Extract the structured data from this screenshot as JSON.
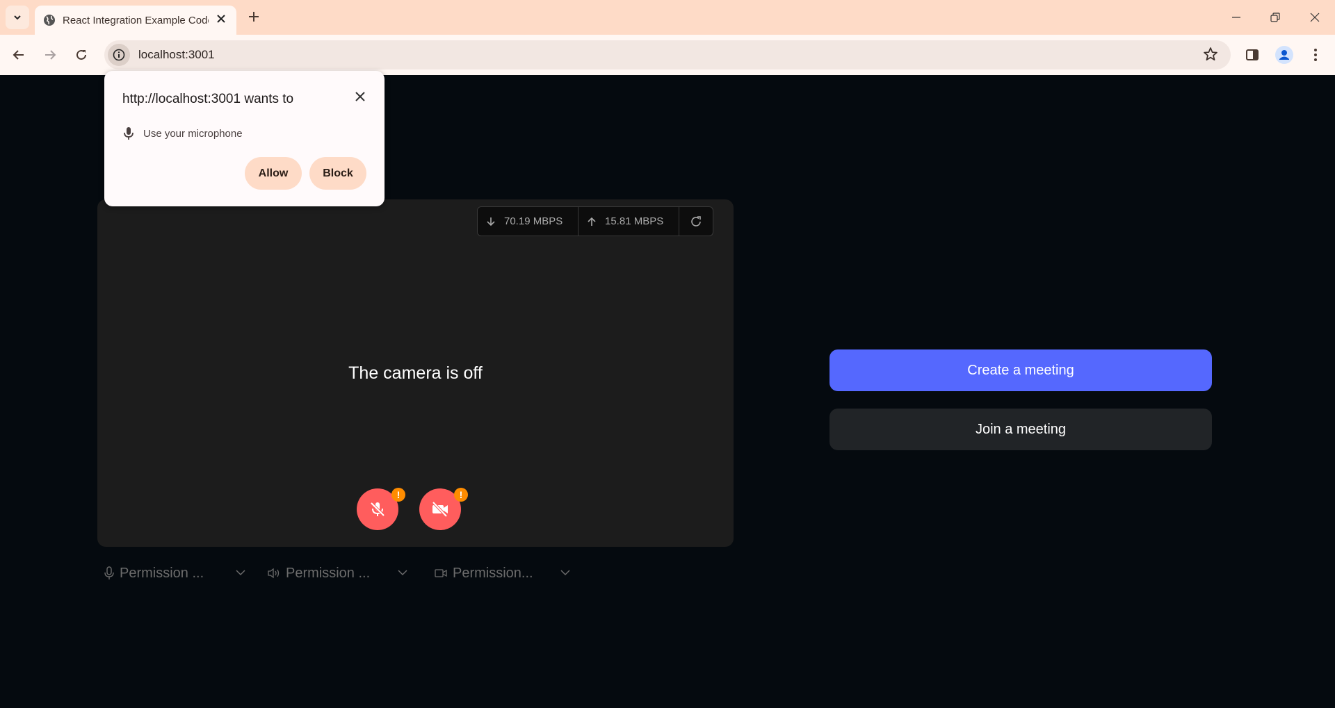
{
  "browser": {
    "tab_title": "React Integration Example Code",
    "url": "localhost:3001",
    "icons": {
      "tab_search": "chevron-down-icon",
      "tab_favicon": "globe-icon",
      "tab_close": "close-icon",
      "new_tab": "plus-icon",
      "back": "arrow-left-icon",
      "forward": "arrow-right-icon",
      "reload": "reload-icon",
      "site_info": "info-icon",
      "bookmark": "star-icon",
      "side_panel": "side-panel-icon",
      "profile": "profile-icon",
      "menu": "kebab-menu-icon",
      "minimize": "minimize-icon",
      "restore": "restore-icon",
      "close_window": "close-icon"
    }
  },
  "permission_popup": {
    "title": "http://localhost:3001 wants to",
    "permission": "Use your microphone",
    "allow_label": "Allow",
    "block_label": "Block"
  },
  "preview": {
    "download_speed": "70.19 MBPS",
    "upload_speed": "15.81 MBPS",
    "camera_status": "The camera is off",
    "mic_badge": "!",
    "cam_badge": "!"
  },
  "selectors": [
    {
      "label": "Permission ...",
      "icon": "microphone-icon"
    },
    {
      "label": "Permission ...",
      "icon": "speaker-icon"
    },
    {
      "label": "Permission...",
      "icon": "video-camera-icon"
    }
  ],
  "actions": {
    "create_label": "Create a meeting",
    "join_label": "Join a meeting"
  },
  "colors": {
    "accent": "#5568fe",
    "danger": "#ff5d5d",
    "warning": "#ff8c00",
    "chrome": "#fedbc7"
  }
}
